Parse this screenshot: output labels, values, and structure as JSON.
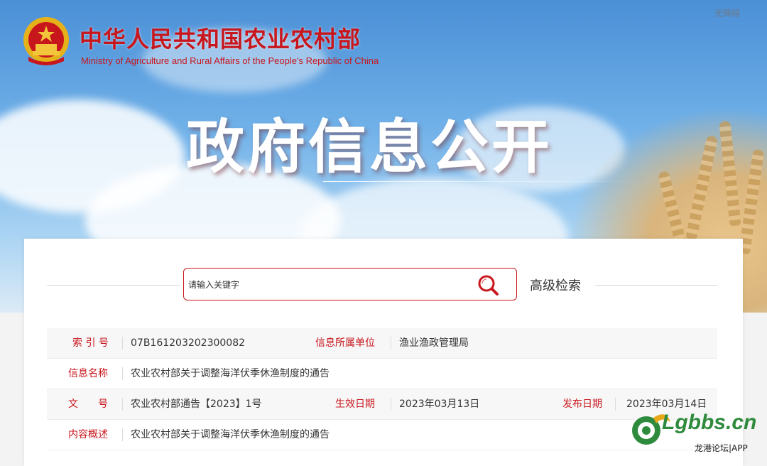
{
  "colors": {
    "accent": "#c8161d",
    "label": "#c8161d",
    "text": "#333333"
  },
  "banner": {
    "topright_text": "无障碍",
    "ministry_cn": "中华人民共和国农业农村部",
    "ministry_en": "Ministry of Agriculture and Rural Affairs of the People's Republic of China",
    "big_title": "政府信息公开"
  },
  "search": {
    "placeholder": "请输入关键字",
    "icon": "search-icon",
    "advanced_label": "高级检索"
  },
  "info": {
    "index_label": "索 引 号",
    "index_value": "07B161203202300082",
    "unit_label": "信息所属单位",
    "unit_value": "渔业渔政管理局",
    "name_label": "信息名称",
    "name_value": "农业农村部关于调整海洋伏季休渔制度的通告",
    "doc_label": "文　　号",
    "doc_value": "农业农村部通告【2023】1号",
    "effective_label": "生效日期",
    "effective_value": "2023年03月13日",
    "publish_label": "发布日期",
    "publish_value": "2023年03月14日",
    "summary_label": "内容概述",
    "summary_value": "农业农村部关于调整海洋伏季休渔制度的通告"
  },
  "watermark": {
    "site": "Lgbbs.cn",
    "sub": "龙港论坛|APP"
  }
}
